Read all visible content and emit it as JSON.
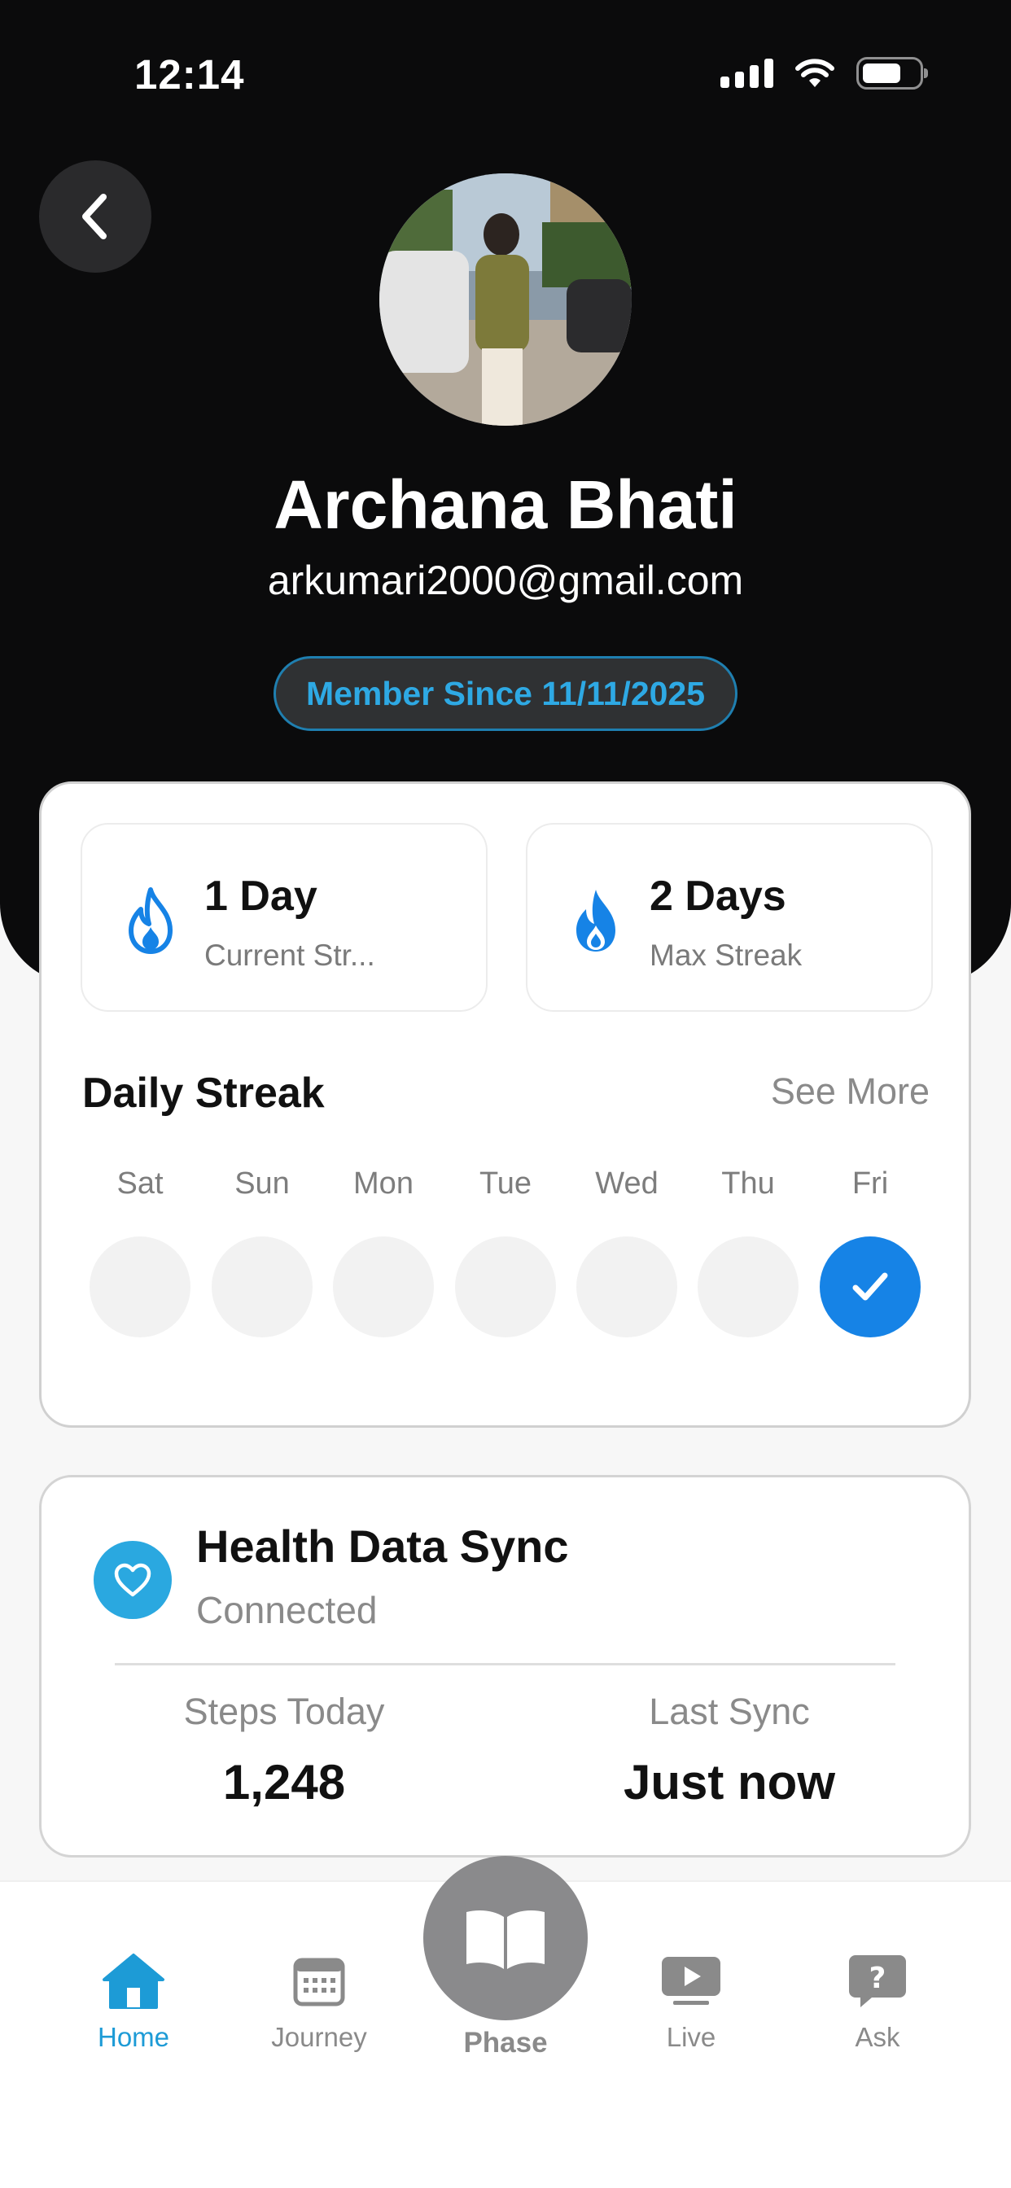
{
  "status_bar": {
    "time": "12:14"
  },
  "profile": {
    "name": "Archana Bhati",
    "email": "arkumari2000@gmail.com",
    "member_since": "Member Since 11/11/2025"
  },
  "streak": {
    "current": {
      "value": "1 Day",
      "label": "Current Str..."
    },
    "max": {
      "value": "2 Days",
      "label": "Max Streak"
    },
    "title": "Daily Streak",
    "see_more": "See More",
    "days": [
      {
        "label": "Sat",
        "done": false
      },
      {
        "label": "Sun",
        "done": false
      },
      {
        "label": "Mon",
        "done": false
      },
      {
        "label": "Tue",
        "done": false
      },
      {
        "label": "Wed",
        "done": false
      },
      {
        "label": "Thu",
        "done": false
      },
      {
        "label": "Fri",
        "done": true
      }
    ]
  },
  "health": {
    "title": "Health Data Sync",
    "status": "Connected",
    "steps_label": "Steps Today",
    "steps_value": "1,248",
    "sync_label": "Last Sync",
    "sync_value": "Just now"
  },
  "tabbar": {
    "home": "Home",
    "journey": "Journey",
    "phase": "Phase",
    "live": "Live",
    "ask": "Ask",
    "active_color": "#1d9bd6",
    "inactive_color": "#8a8a8a"
  },
  "colors": {
    "accent_blue": "#1683e6",
    "badge_text": "#2ea9e4",
    "heart_bg": "#2aa8e0"
  }
}
